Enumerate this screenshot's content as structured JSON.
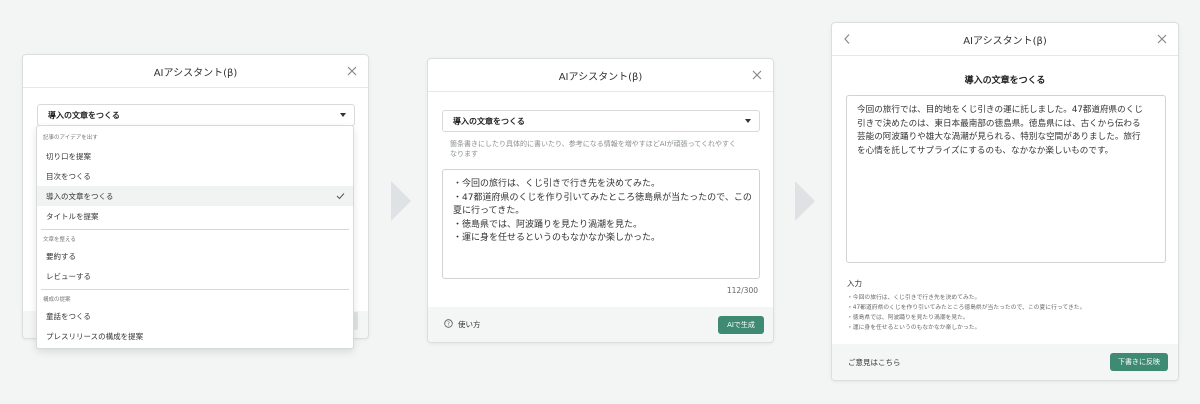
{
  "assistant_title": "AIアシスタント(β)",
  "panel1": {
    "selected_option": "導入の文章をつくる",
    "dropdown": {
      "groups": [
        {
          "label": "記事のアイデアを出す",
          "items": [
            "切り口を提案",
            "目次をつくる",
            "導入の文章をつくる",
            "タイトルを提案"
          ]
        },
        {
          "label": "文章を整える",
          "items": [
            "要約する",
            "レビューする"
          ]
        },
        {
          "label": "構成の提案",
          "items": [
            "童話をつくる",
            "プレスリリースの構成を提案"
          ]
        }
      ]
    }
  },
  "panel2": {
    "selected_option": "導入の文章をつくる",
    "help_text_lines": [
      "箇条書きにしたり具体的に書いたり、参考になる情報を増やすほどAIが頑張ってくれやすく",
      "なります"
    ],
    "input_lines": [
      "・今回の旅行は、くじ引きで行き先を決めてみた。",
      "・47都道府県のくじを作り引いてみたところ徳島県が当たったので、この",
      "夏に行ってきた。",
      "・徳島県では、阿波踊りを見たり渦潮を見た。",
      "・運に身を任せるというのもなかなか楽しかった。"
    ],
    "char_count": "112/300",
    "help_link": "使い方",
    "generate_button": "AIで生成"
  },
  "panel3": {
    "heading": "導入の文章をつくる",
    "output_lines": [
      "今回の旅行では、目的地をくじ引きの運に託しました。47都道府県のくじ",
      "引きで決めたのは、東日本最南部の徳島県。徳島県には、古くから伝わる",
      "芸能の阿波踊りや雄大な渦潮が見られる、特別な空間がありました。旅行",
      "を心情を託してサプライズにするのも、なかなか楽しいものです。"
    ],
    "input_label": "入力",
    "input_lines": [
      "・今回の旅行は、くじ引きで行き先を決めてみた。",
      "・47都道府県のくじを作り引いてみたところ徳島県が当たったので、この夏に行ってきた。",
      "・徳島県では、阿波踊りを見たり渦潮を見た。",
      "・運に身を任せるというのもなかなか楽しかった。"
    ],
    "feedback_link": "ご意見はこちら",
    "apply_button": "下書きに反映"
  },
  "colors": {
    "accent": "#3e8a72",
    "arrow": "#dee2e4"
  },
  "icons": [
    "close-icon",
    "chevron-left-icon",
    "caret-down-icon",
    "checkmark-icon",
    "help-circle-icon",
    "next-step-arrow-icon"
  ]
}
